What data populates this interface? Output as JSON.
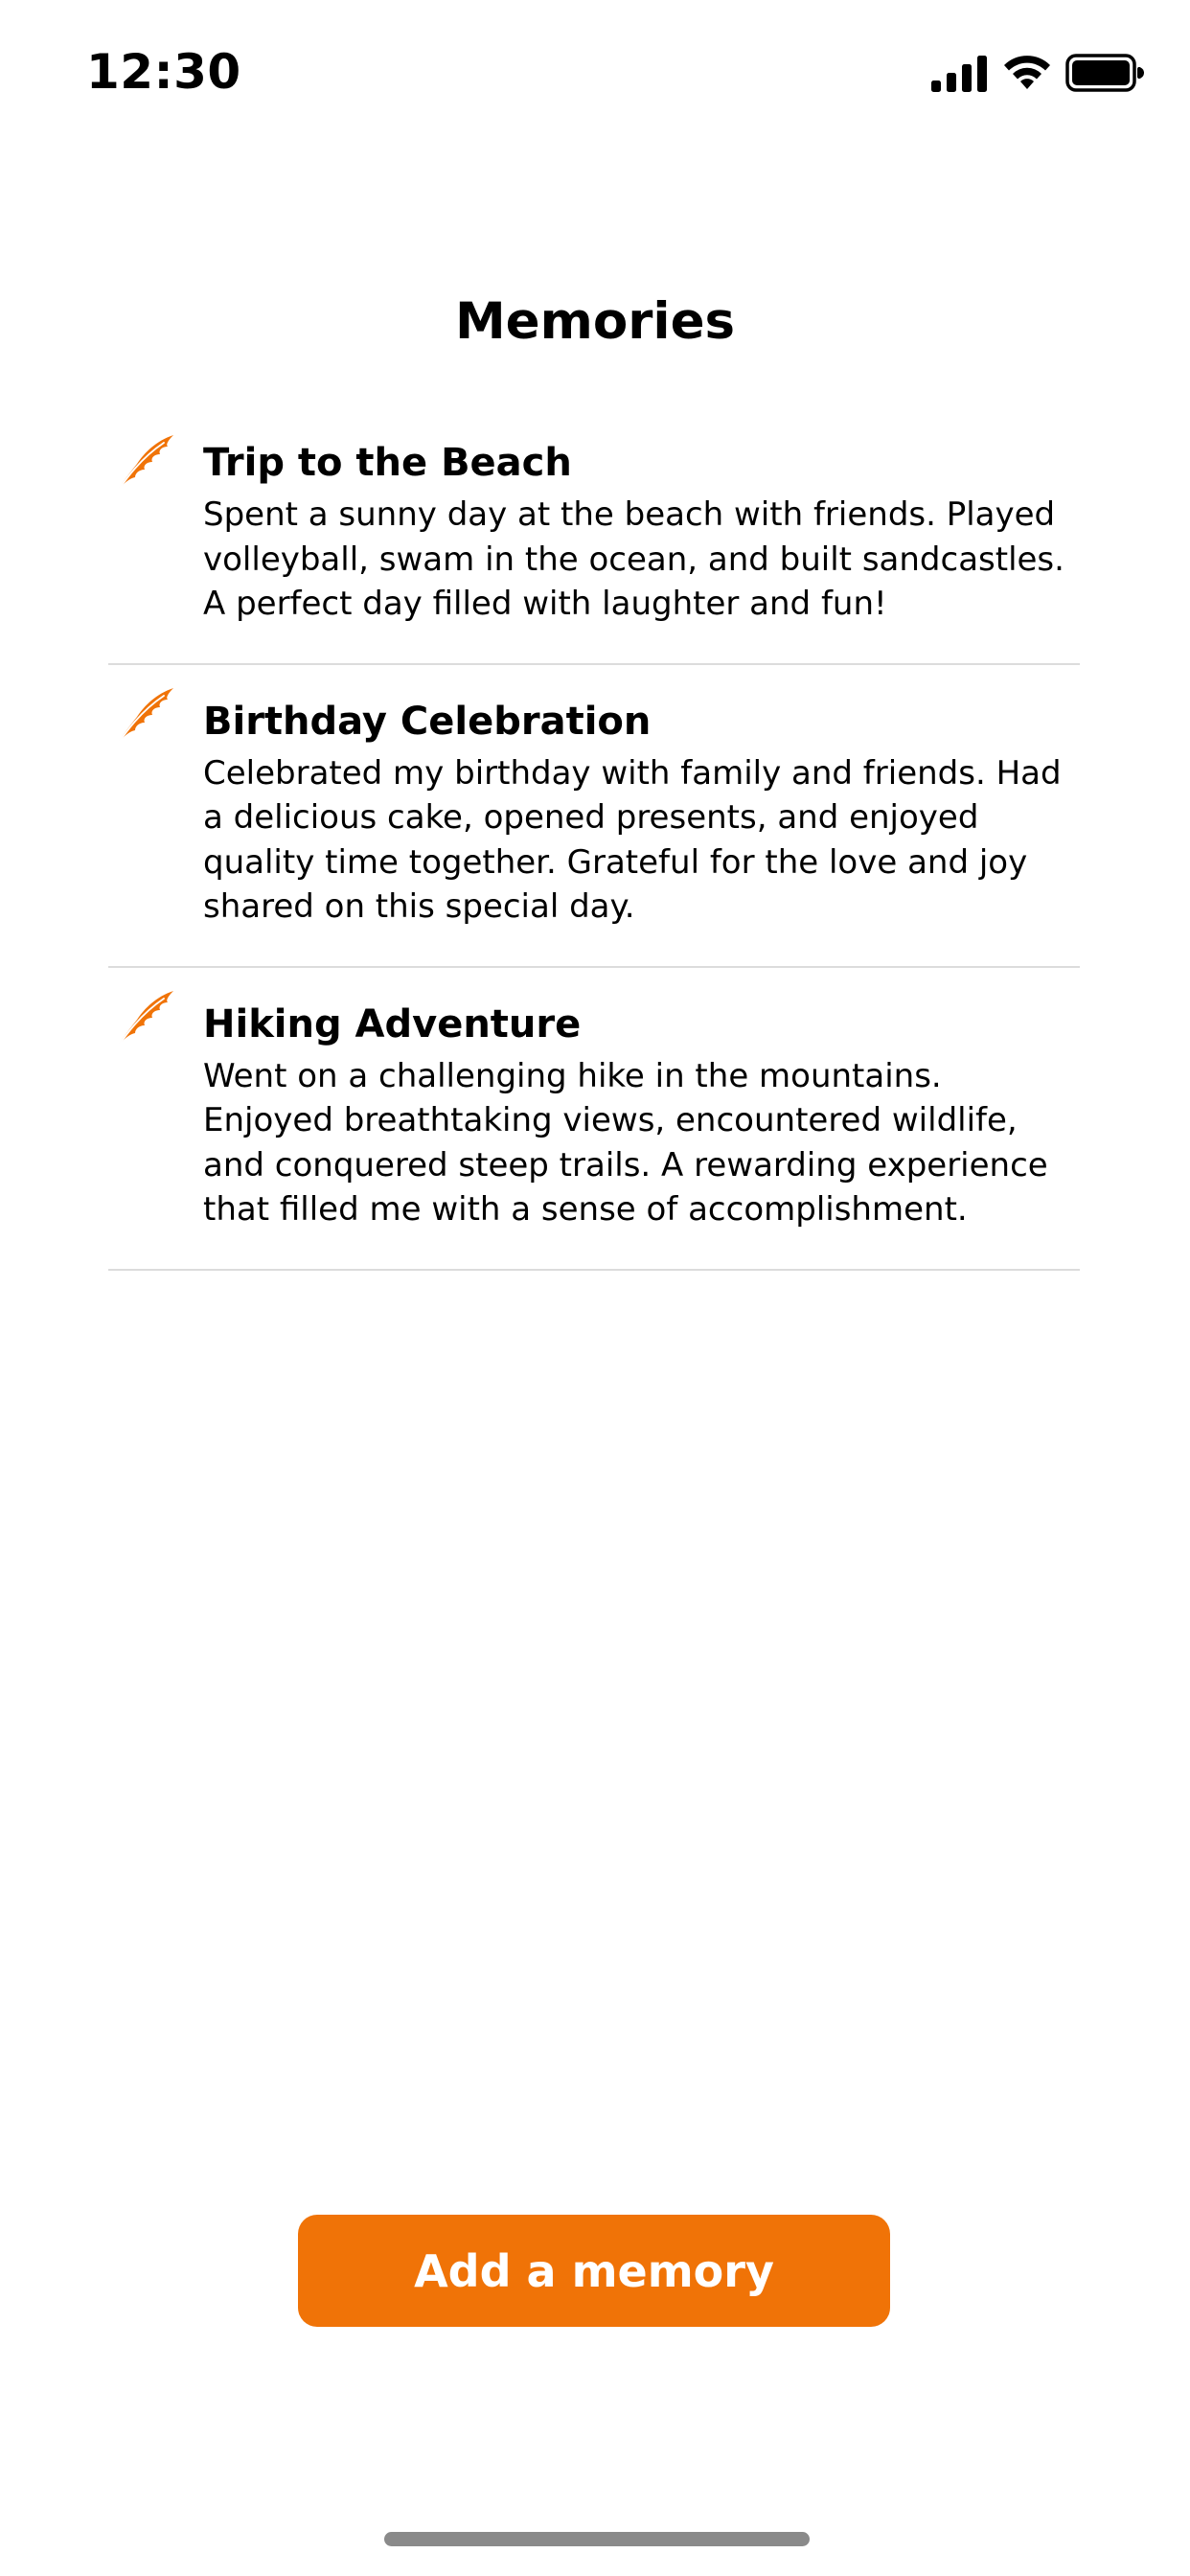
{
  "status_bar": {
    "time": "12:30"
  },
  "header": {
    "title": "Memories"
  },
  "colors": {
    "accent": "#f07307",
    "divider": "#dcdcdc",
    "home_indicator": "#8a8a8a"
  },
  "memories": [
    {
      "icon": "feather-icon",
      "title": "Trip to the Beach",
      "description": "Spent a sunny day at the beach with friends. Played volleyball, swam in the ocean, and built sandcastles. A perfect day filled with laughter and fun!"
    },
    {
      "icon": "feather-icon",
      "title": "Birthday Celebration",
      "description": "Celebrated my birthday with family and friends. Had a delicious cake, opened presents, and enjoyed quality time together. Grateful for the love and joy shared on this special day."
    },
    {
      "icon": "feather-icon",
      "title": "Hiking Adventure",
      "description": "Went on a challenging hike in the mountains. Enjoyed breathtaking views, encountered wildlife, and conquered steep trails. A rewarding experience that filled me with a sense of accomplishment."
    }
  ],
  "actions": {
    "add_label": "Add a memory"
  }
}
